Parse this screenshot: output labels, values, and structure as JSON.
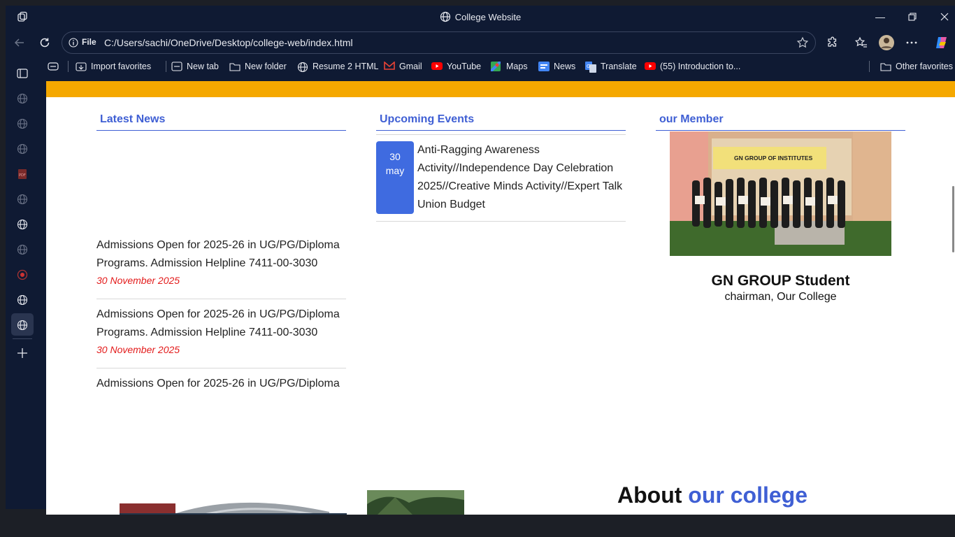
{
  "window": {
    "title": "College Website"
  },
  "address": {
    "file_label": "File",
    "url": "C:/Users/sachi/OneDrive/Desktop/college-web/index.html"
  },
  "bookmarks": {
    "import": "Import favorites",
    "items": [
      "New tab",
      "New folder",
      "Resume 2 HTML",
      "Gmail",
      "YouTube",
      "Maps",
      "News",
      "Translate",
      "(55) Introduction to..."
    ],
    "other": "Other favorites"
  },
  "news": {
    "heading": "Latest News",
    "items": [
      {
        "text": "Admissions Open for 2025-26 in UG/PG/Diploma Programs. Admission Helpline 7411-00-3030",
        "date": "30 November 2025"
      },
      {
        "text": "Admissions Open for 2025-26 in UG/PG/Diploma Programs. Admission Helpline 7411-00-3030",
        "date": "30 November 2025"
      },
      {
        "text": "Admissions Open for 2025-26 in UG/PG/Diploma"
      }
    ]
  },
  "events": {
    "heading": "Upcoming Events",
    "day": "30",
    "month": "may",
    "text": "Anti-Ragging Awareness Activity//Independence Day Celebration 2025//Creative Minds Activity//Expert Talk Union Budget"
  },
  "member": {
    "heading": "our Member",
    "banner": "GN GROUP OF INSTITUTES",
    "name": "GN GROUP Student",
    "role": "chairman, Our College"
  },
  "about": {
    "prefix": "About",
    "highlight": "our college"
  },
  "colors": {
    "accent": "#3f5fd4",
    "band": "#f5a800",
    "event": "#3f6be0",
    "date": "#e31b1b"
  }
}
